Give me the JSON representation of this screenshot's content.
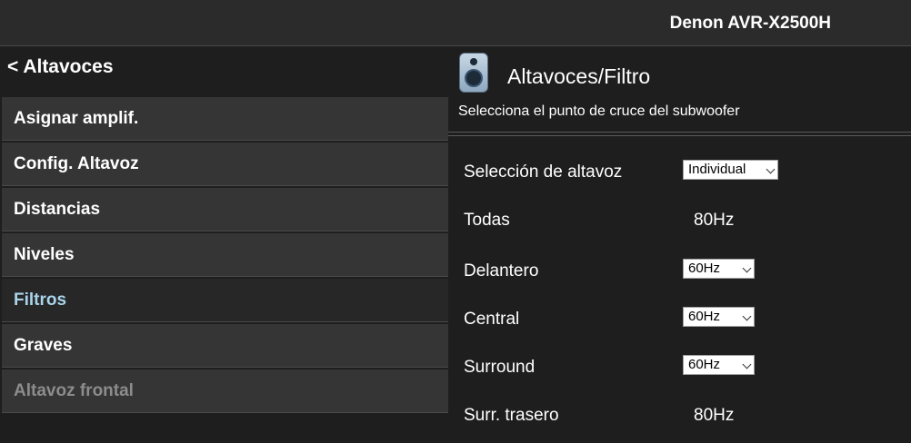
{
  "header": {
    "device_name": "Denon AVR-X2500H"
  },
  "sidebar": {
    "back_label": "< Altavoces",
    "items": [
      {
        "label": "Asignar amplif.",
        "state": "normal"
      },
      {
        "label": "Config. Altavoz",
        "state": "normal"
      },
      {
        "label": "Distancias",
        "state": "normal"
      },
      {
        "label": "Niveles",
        "state": "normal"
      },
      {
        "label": "Filtros",
        "state": "active"
      },
      {
        "label": "Graves",
        "state": "normal"
      },
      {
        "label": "Altavoz frontal",
        "state": "disabled"
      }
    ]
  },
  "main": {
    "icon": "speaker-icon",
    "title": "Altavoces/Filtro",
    "subtitle": "Selecciona el punto de cruce del subwoofer",
    "rows": [
      {
        "label": "Selección de altavoz",
        "type": "select",
        "value": "Individual"
      },
      {
        "label": "Todas",
        "type": "text",
        "value": "80Hz"
      },
      {
        "label": "Delantero",
        "type": "select",
        "value": "60Hz"
      },
      {
        "label": "Central",
        "type": "select",
        "value": "60Hz"
      },
      {
        "label": "Surround",
        "type": "select",
        "value": "60Hz"
      },
      {
        "label": "Surr. trasero",
        "type": "text",
        "value": "80Hz"
      }
    ]
  },
  "colors": {
    "background": "#1e1e1e",
    "menu_item": "#353535",
    "active_text": "#a9d4ea",
    "disabled_text": "#8c8c8c"
  }
}
